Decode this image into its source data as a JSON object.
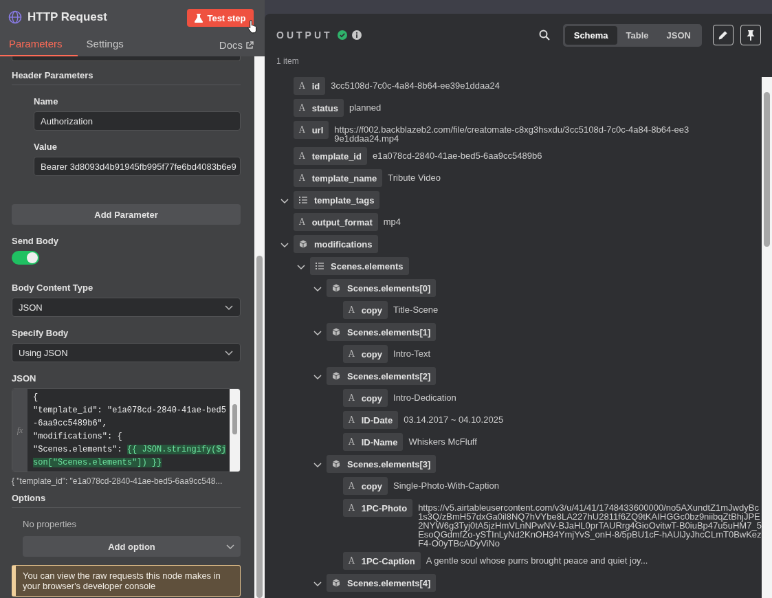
{
  "node_panel": {
    "title": "HTTP Request",
    "test_button": "Test step",
    "tabs": [
      {
        "label": "Parameters",
        "selected": true
      },
      {
        "label": "Settings",
        "selected": false
      }
    ],
    "docs_link": "Docs",
    "header_parameters": {
      "title": "Header Parameters",
      "fields": [
        {
          "label": "Name",
          "value": "Authorization"
        },
        {
          "label": "Value",
          "value": "Bearer 3d8093d4b91945fb995f77fe6bd4083b6e9"
        }
      ],
      "add_button": "Add Parameter"
    },
    "send_body": {
      "label": "Send Body",
      "on": true
    },
    "body_content_type": {
      "label": "Body Content Type",
      "value": "JSON"
    },
    "specify_body": {
      "label": "Specify Body",
      "value": "Using JSON"
    },
    "json_editor": {
      "label": "JSON",
      "gutter_label": "fx",
      "lines": [
        {
          "code": "{"
        },
        {
          "code": "\"template_id\": \"e1a078cd-2840-41ae-bed5-6aa9cc5489b6\","
        },
        {
          "code": "\"modifications\": {"
        },
        {
          "code": "\"Scenes.elements\": ",
          "expression": "{{ JSON.stringify($json[\"Scenes.elements\"]) }}"
        }
      ],
      "preview": "{ \"template_id\": \"e1a078cd-2840-41ae-bed5-6aa9cc548..."
    },
    "options": {
      "title": "Options",
      "empty": "No properties",
      "add_button": "Add option"
    },
    "notice": "You can view the raw requests this node makes in your browser's developer console"
  },
  "output_panel": {
    "title": "OUTPUT",
    "views": [
      {
        "label": "Schema",
        "selected": true
      },
      {
        "label": "Table",
        "selected": false
      },
      {
        "label": "JSON",
        "selected": false
      }
    ],
    "item_count": "1 item",
    "schema": [
      {
        "kind": "string",
        "type_label": "A",
        "key": "id",
        "value": "3cc5108d-7c0c-4a84-8b64-ee39e1ddaa24"
      },
      {
        "kind": "string",
        "type_label": "A",
        "key": "status",
        "value": "planned"
      },
      {
        "kind": "string",
        "type_label": "A",
        "key": "url",
        "value": "https://f002.backblazeb2.com/file/creatomate-c8xg3hsxdu/3cc5108d-7c0c-4a84-8b64-ee39e1ddaa24.mp4"
      },
      {
        "kind": "string",
        "type_label": "A",
        "key": "template_id",
        "value": "e1a078cd-2840-41ae-bed5-6aa9cc5489b6"
      },
      {
        "kind": "string",
        "type_label": "A",
        "key": "template_name",
        "value": "Tribute Video"
      },
      {
        "kind": "array",
        "key": "template_tags",
        "expanded": true
      },
      {
        "kind": "string",
        "type_label": "A",
        "key": "output_format",
        "value": "mp4"
      },
      {
        "kind": "object",
        "key": "modifications",
        "expanded": true,
        "children": [
          {
            "kind": "array",
            "key": "Scenes.elements",
            "expanded": true,
            "children": [
              {
                "kind": "object",
                "key": "Scenes.elements[0]",
                "expanded": true,
                "children": [
                  {
                    "kind": "string",
                    "type_label": "A",
                    "key": "copy",
                    "value": "Title-Scene"
                  }
                ]
              },
              {
                "kind": "object",
                "key": "Scenes.elements[1]",
                "expanded": true,
                "children": [
                  {
                    "kind": "string",
                    "type_label": "A",
                    "key": "copy",
                    "value": "Intro-Text"
                  }
                ]
              },
              {
                "kind": "object",
                "key": "Scenes.elements[2]",
                "expanded": true,
                "children": [
                  {
                    "kind": "string",
                    "type_label": "A",
                    "key": "copy",
                    "value": "Intro-Dedication"
                  },
                  {
                    "kind": "string",
                    "type_label": "A",
                    "key": "ID-Date",
                    "value": "03.14.2017 ~ 04.10.2025"
                  },
                  {
                    "kind": "string",
                    "type_label": "A",
                    "key": "ID-Name",
                    "value": "Whiskers McFluff"
                  }
                ]
              },
              {
                "kind": "object",
                "key": "Scenes.elements[3]",
                "expanded": true,
                "children": [
                  {
                    "kind": "string",
                    "type_label": "A",
                    "key": "copy",
                    "value": "Single-Photo-With-Caption"
                  },
                  {
                    "kind": "string",
                    "type_label": "A",
                    "key": "1PC-Photo",
                    "value": "https://v5.airtableusercontent.com/v3/u/41/41/1748433600000/no5AXundtZ1mJwdyBc1s3Q/zBmH57dxGa0il8NQ7hVYbe8LA227hU2811f6ZQ9tKAIHGGc0bz9niibqZtBhjJPE2NYW6g3Tyj0tA5jzHmVLnNPwNV-BJaHL0prTAURrg4GioOvitwT-B0iuBp47u5uHM7_5EsoQGdmfZo-ySTInLyNd2KnOH34YmjYvS_onH-8/5pBU1cF-hAUlJyJhcCLmT0BwKezF4-O0yTBcADyViNo"
                  },
                  {
                    "kind": "string",
                    "type_label": "A",
                    "key": "1PC-Caption",
                    "value": "A gentle soul whose purrs brought peace and quiet joy..."
                  }
                ]
              },
              {
                "kind": "object",
                "key": "Scenes.elements[4]",
                "expanded": true
              }
            ]
          }
        ]
      }
    ]
  }
}
